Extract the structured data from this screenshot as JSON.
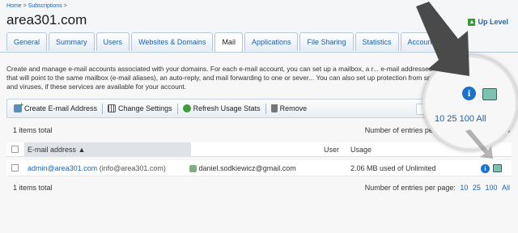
{
  "breadcrumb": {
    "home": "Home",
    "sep": ">",
    "subs": "Subscriptions",
    "sep2": ">"
  },
  "title": "area301.com",
  "up_level": "Up Level",
  "tabs": [
    {
      "label": "General"
    },
    {
      "label": "Summary"
    },
    {
      "label": "Users"
    },
    {
      "label": "Websites & Domains"
    },
    {
      "label": "Mail",
      "active": true
    },
    {
      "label": "Applications"
    },
    {
      "label": "File Sharing"
    },
    {
      "label": "Statistics"
    },
    {
      "label": "Account"
    }
  ],
  "intro": "Create and manage e-mail accounts associated with your domains. For each e-mail account, you can set up a mailbox, a r... e-mail addresses that will point to the same mailbox (e-mail aliases), an auto-reply, and mail forwarding to one or sever... You can also set up protection from spam and viruses, if these services are available for your account.",
  "toolbar": {
    "create": "Create E-mail Address",
    "settings": "Change Settings",
    "refresh": "Refresh Usage Stats",
    "remove": "Remove"
  },
  "items_total": "1 items total",
  "entries": {
    "label": "Number of entries per page:",
    "opt10": "10",
    "opt25": "25",
    "opt100": "100",
    "all": "All"
  },
  "table": {
    "col_email": "E-mail address",
    "col_user": "User",
    "col_usage": "Usage",
    "rows": [
      {
        "email": "admin@area301.com",
        "alias": "(info@area301.com)",
        "user": "daniel.sodkiewicz@gmail.com",
        "usage": "2.06 MB used of Unlimited"
      }
    ]
  },
  "magnifier": {
    "entries": "10  25  100  All"
  },
  "colors": {
    "link": "#2266aa",
    "info_icon": "#1a73c9",
    "arrow": "#4a4a4a"
  }
}
